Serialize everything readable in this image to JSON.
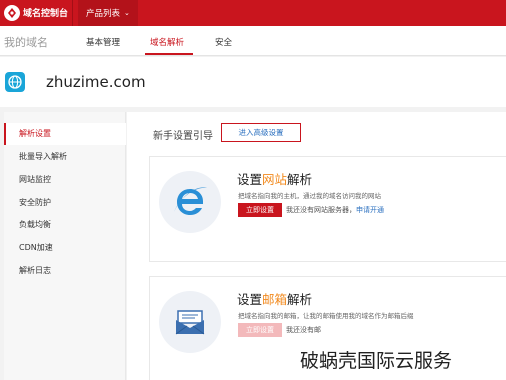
{
  "topbar": {
    "brand": "域名控制台",
    "products_label": "产品列表",
    "products_chevron": "⌄"
  },
  "subnav": {
    "title": "我的域名",
    "tabs": [
      {
        "label": "基本管理",
        "active": false
      },
      {
        "label": "域名解析",
        "active": true
      },
      {
        "label": "安全",
        "active": false
      }
    ]
  },
  "domain": {
    "name": "zhuzime.com"
  },
  "sidebar": {
    "items": [
      {
        "label": "解析设置",
        "active": true
      },
      {
        "label": "批量导入解析",
        "active": false
      },
      {
        "label": "网站监控",
        "active": false
      },
      {
        "label": "安全防护",
        "active": false
      },
      {
        "label": "负载均衡",
        "active": false
      },
      {
        "label": "CDN加速",
        "active": false
      },
      {
        "label": "解析日志",
        "active": false
      }
    ]
  },
  "main": {
    "guide_title": "新手设置引导",
    "advanced_button": "进入高级设置",
    "cards": [
      {
        "title_prefix": "设置",
        "title_highlight": "网站",
        "title_suffix": "解析",
        "description": "把域名指向我的主机，通过我的域名访问我的网站",
        "button": "立即设置",
        "note": "我还没有网站服务器，",
        "link": "申请开通"
      },
      {
        "title_prefix": "设置",
        "title_highlight": "邮箱",
        "title_suffix": "解析",
        "description": "把域名指向我的邮箱，让我的邮箱使用我的域名作为邮箱后缀",
        "button": "立即设置",
        "note": "我还没有邮"
      }
    ]
  },
  "watermark": "破蜗壳国际云服务",
  "colors": {
    "brand_red": "#c9151e",
    "highlight_orange": "#f28a1e",
    "link_blue": "#2a6fbf"
  }
}
